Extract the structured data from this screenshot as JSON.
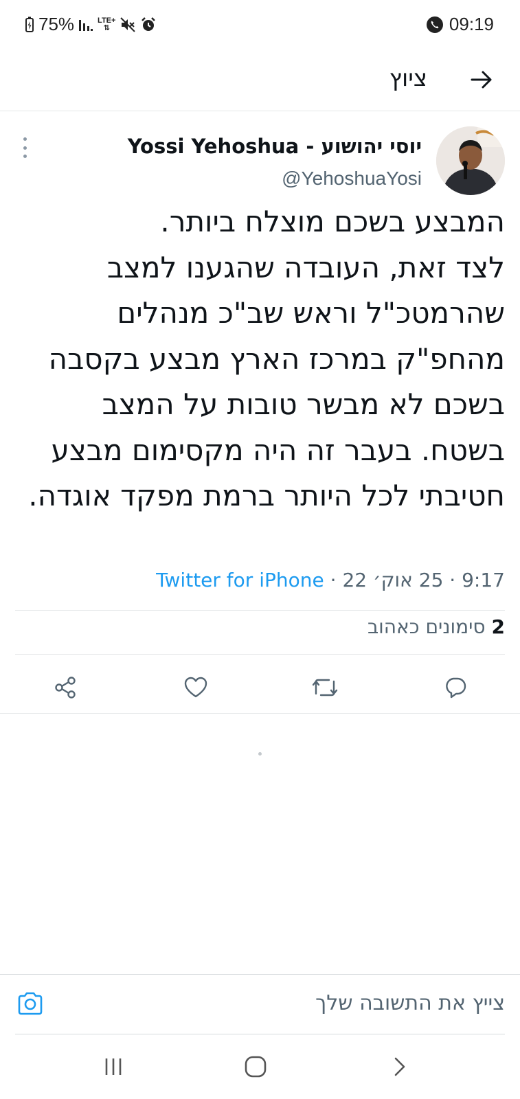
{
  "status_bar": {
    "battery": "75%",
    "network": "LTE+",
    "time": "09:19"
  },
  "header": {
    "title": "ציוץ",
    "back_icon": "arrow-right-icon"
  },
  "tweet": {
    "author_name": "יוסי יהושוע - Yossi Yehoshua",
    "handle": "@YehoshuaYosi",
    "text": "המבצע בשכם מוצלח ביותר.\nלצד זאת,  העובדה שהגענו למצב שהרמטכ\"ל וראש שב\"כ מנהלים מהחפ\"ק במרכז הארץ מבצע בקסבה בשכם לא מבשר טובות על המצב בשטח. בעבר זה היה מקסימום מבצע חטיבתי לכל היותר ברמת מפקד אוגדה.",
    "time": "9:17",
    "date": "25 אוק׳ 22",
    "source": "Twitter for iPhone",
    "likes_count": "2",
    "likes_label": "סימונים כאהוב"
  },
  "actions": [
    "reply-icon",
    "retweet-icon",
    "like-icon",
    "share-icon"
  ],
  "reply": {
    "placeholder": "צייץ את התשובה שלך"
  },
  "colors": {
    "accent": "#1d9bf0",
    "secondary_text": "#536471",
    "divider": "#e4e6e8"
  }
}
